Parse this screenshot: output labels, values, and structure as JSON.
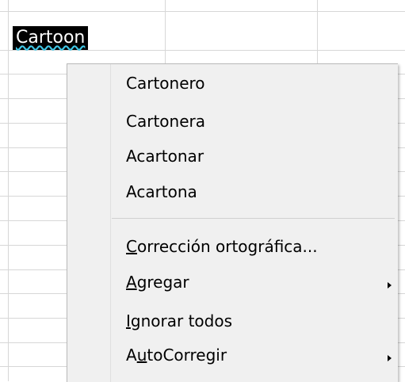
{
  "cell": {
    "text": "Cartoon"
  },
  "menu": {
    "suggestions": [
      "Cartonero",
      "Cartonera",
      "Acartonar",
      "Acartona"
    ],
    "spell_check": {
      "mnemonic": "C",
      "rest": "orrección ortográfica..."
    },
    "add": {
      "mnemonic": "A",
      "rest": "gregar"
    },
    "ignore_all": {
      "mnemonic": "I",
      "rest": "gnorar todos"
    },
    "autocorrect": {
      "pre": "A",
      "mnemonic": "u",
      "rest": "toCorregir"
    }
  },
  "colors": {
    "menu_background": "#f0f0f0",
    "grid_line": "#d7d7d7",
    "selection_background": "#000000",
    "spell_underline": "#3fc7e6"
  }
}
